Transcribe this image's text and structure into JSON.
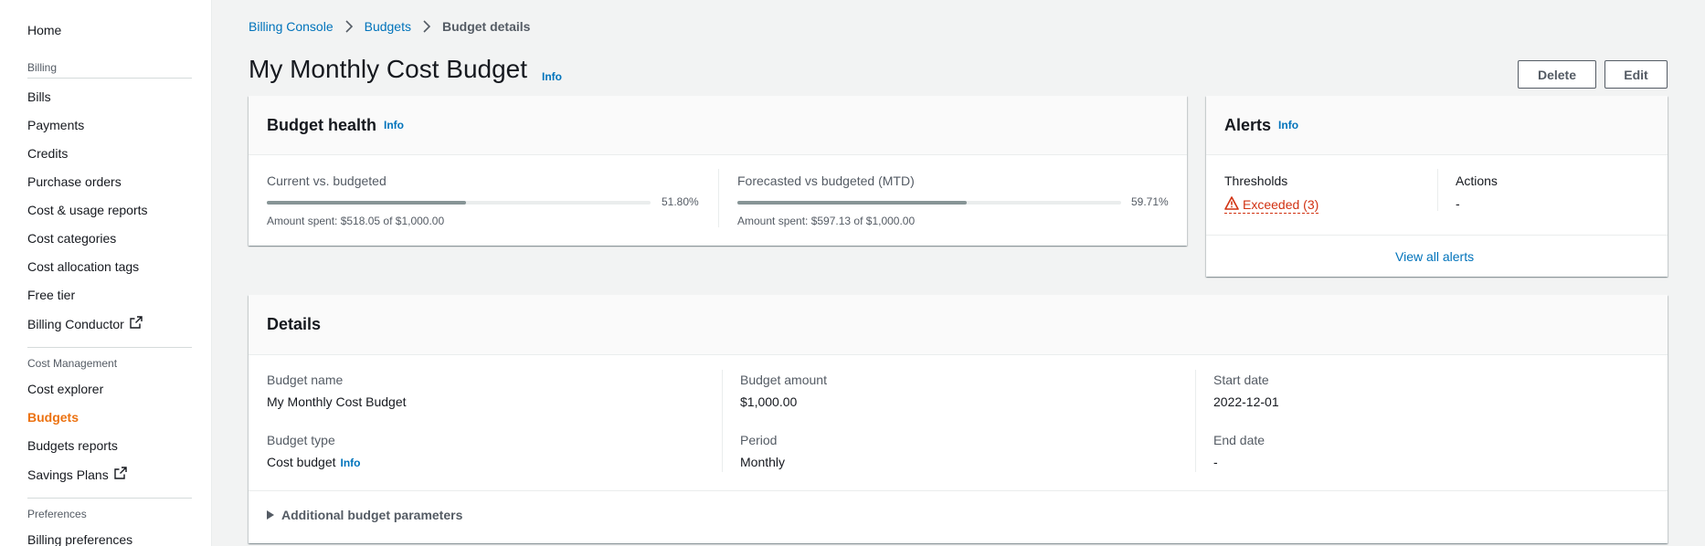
{
  "sidebar": {
    "home": "Home",
    "sections": [
      {
        "title": "Billing",
        "items": [
          "Bills",
          "Payments",
          "Credits",
          "Purchase orders",
          "Cost & usage reports",
          "Cost categories",
          "Cost allocation tags",
          "Free tier",
          "Billing Conductor"
        ]
      },
      {
        "title": "Cost Management",
        "items": [
          "Cost explorer",
          "Budgets",
          "Budgets reports",
          "Savings Plans"
        ]
      },
      {
        "title": "Preferences",
        "items": [
          "Billing preferences"
        ]
      }
    ],
    "active_item": "Budgets",
    "external_link_items": [
      "Billing Conductor",
      "Savings Plans"
    ]
  },
  "breadcrumb": [
    "Billing Console",
    "Budgets",
    "Budget details"
  ],
  "header": {
    "title": "My Monthly Cost Budget",
    "info": "Info",
    "delete_label": "Delete",
    "edit_label": "Edit"
  },
  "budget_health": {
    "title": "Budget health",
    "info": "Info",
    "current": {
      "label": "Current vs. budgeted",
      "percent_text": "51.80%",
      "percent": 51.8,
      "amount_text": "Amount spent: $518.05 of $1,000.00"
    },
    "forecast": {
      "label": "Forecasted vs budgeted (MTD)",
      "percent_text": "59.71%",
      "percent": 59.71,
      "amount_text": "Amount spent: $597.13 of $1,000.00"
    }
  },
  "alerts": {
    "title": "Alerts",
    "info": "Info",
    "thresholds_label": "Thresholds",
    "thresholds_value": "Exceeded (3)",
    "actions_label": "Actions",
    "actions_value": "-",
    "view_all": "View all alerts"
  },
  "details": {
    "title": "Details",
    "budget_name_label": "Budget name",
    "budget_name": "My Monthly Cost Budget",
    "budget_amount_label": "Budget amount",
    "budget_amount": "$1,000.00",
    "start_date_label": "Start date",
    "start_date": "2022-12-01",
    "budget_type_label": "Budget type",
    "budget_type": "Cost budget",
    "budget_type_info": "Info",
    "period_label": "Period",
    "period": "Monthly",
    "end_date_label": "End date",
    "end_date": "-",
    "additional": "Additional budget parameters"
  },
  "colors": {
    "accent": "#ec7211",
    "link": "#0073bb",
    "error": "#d13212"
  }
}
